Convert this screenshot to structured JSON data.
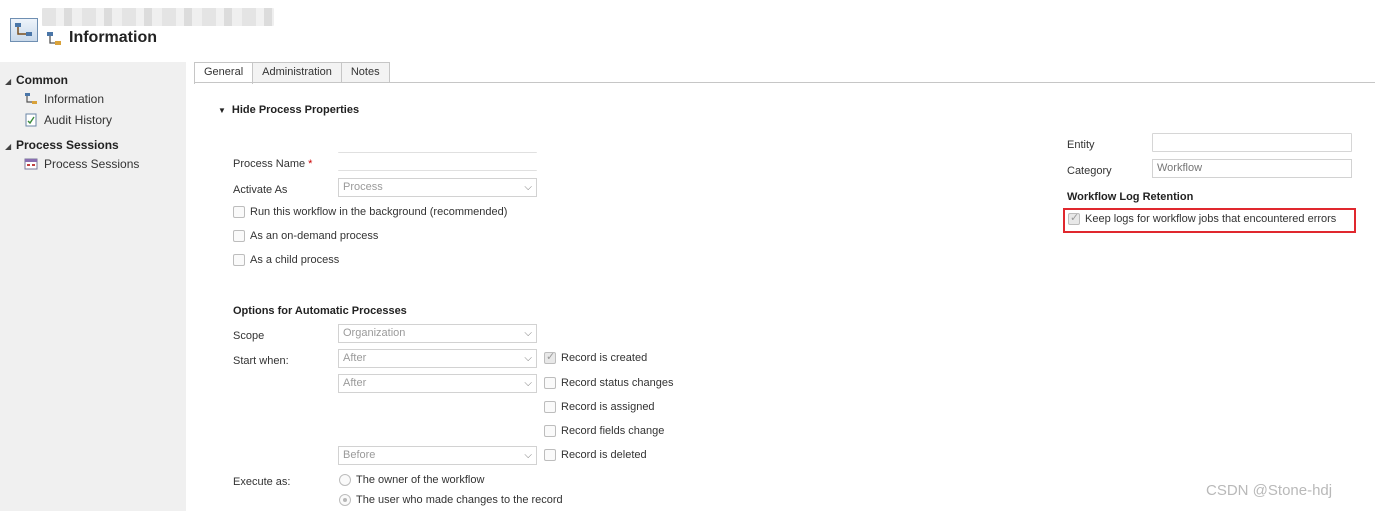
{
  "header": {
    "title": "Information"
  },
  "nav": {
    "groups": [
      {
        "label": "Common",
        "items": [
          {
            "label": "Information",
            "icon": "process-icon"
          },
          {
            "label": "Audit History",
            "icon": "audit-history-icon"
          }
        ]
      },
      {
        "label": "Process Sessions",
        "items": [
          {
            "label": "Process Sessions",
            "icon": "process-sessions-icon"
          }
        ]
      }
    ]
  },
  "tabs": [
    "General",
    "Administration",
    "Notes"
  ],
  "section": {
    "title": "Hide Process Properties"
  },
  "form": {
    "process_name_label": "Process Name",
    "required_mark": "*",
    "activate_as_label": "Activate As",
    "activate_as_value": "Process",
    "checkboxes": [
      {
        "label": "Run this workflow in the background (recommended)",
        "checked": false
      },
      {
        "label": "As an on-demand process",
        "checked": false
      },
      {
        "label": "As a child process",
        "checked": false
      }
    ]
  },
  "right_panel": {
    "entity_label": "Entity",
    "category_label": "Category",
    "category_value": "Workflow",
    "log_retention_heading": "Workflow Log Retention",
    "keep_logs_label": "Keep logs for workflow jobs that encountered errors",
    "keep_logs_checked": true
  },
  "automatic": {
    "heading": "Options for Automatic Processes",
    "scope_label": "Scope",
    "scope_value": "Organization",
    "start_when_label": "Start when:",
    "triggers": [
      {
        "select": "After",
        "label": "Record is created",
        "checked": true
      },
      {
        "select": "After",
        "label": "Record status changes",
        "checked": false
      },
      {
        "select": null,
        "label": "Record is assigned",
        "checked": false
      },
      {
        "select": null,
        "label": "Record fields change",
        "checked": false
      },
      {
        "select": "Before",
        "label": "Record is deleted",
        "checked": false
      }
    ],
    "execute_as_label": "Execute as:",
    "execute_options": [
      {
        "label": "The owner of the workflow",
        "selected": false
      },
      {
        "label": "The user who made changes to the record",
        "selected": true
      }
    ]
  },
  "watermark": "CSDN @Stone-hdj",
  "colors": {
    "highlight": "#e0282e",
    "nav_bg": "#f0f0f0"
  }
}
